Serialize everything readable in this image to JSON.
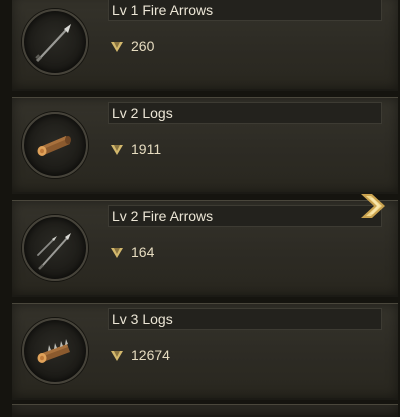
{
  "items": [
    {
      "name": "Lv 1 Fire Arrows",
      "power": "260",
      "icon": "fire-arrow-icon"
    },
    {
      "name": "Lv 2 Logs",
      "power": "1911",
      "icon": "log-icon"
    },
    {
      "name": "Lv 2 Fire Arrows",
      "power": "164",
      "icon": "fire-arrows-pair-icon"
    },
    {
      "name": "Lv 3 Logs",
      "power": "12674",
      "icon": "spiked-log-icon"
    }
  ],
  "icons": {
    "power": "power-diamond-icon",
    "next": "chevron-right-icon"
  },
  "colors": {
    "card": "#2d2b24",
    "gold": "#d3b86c",
    "text": "#ece6d6"
  }
}
